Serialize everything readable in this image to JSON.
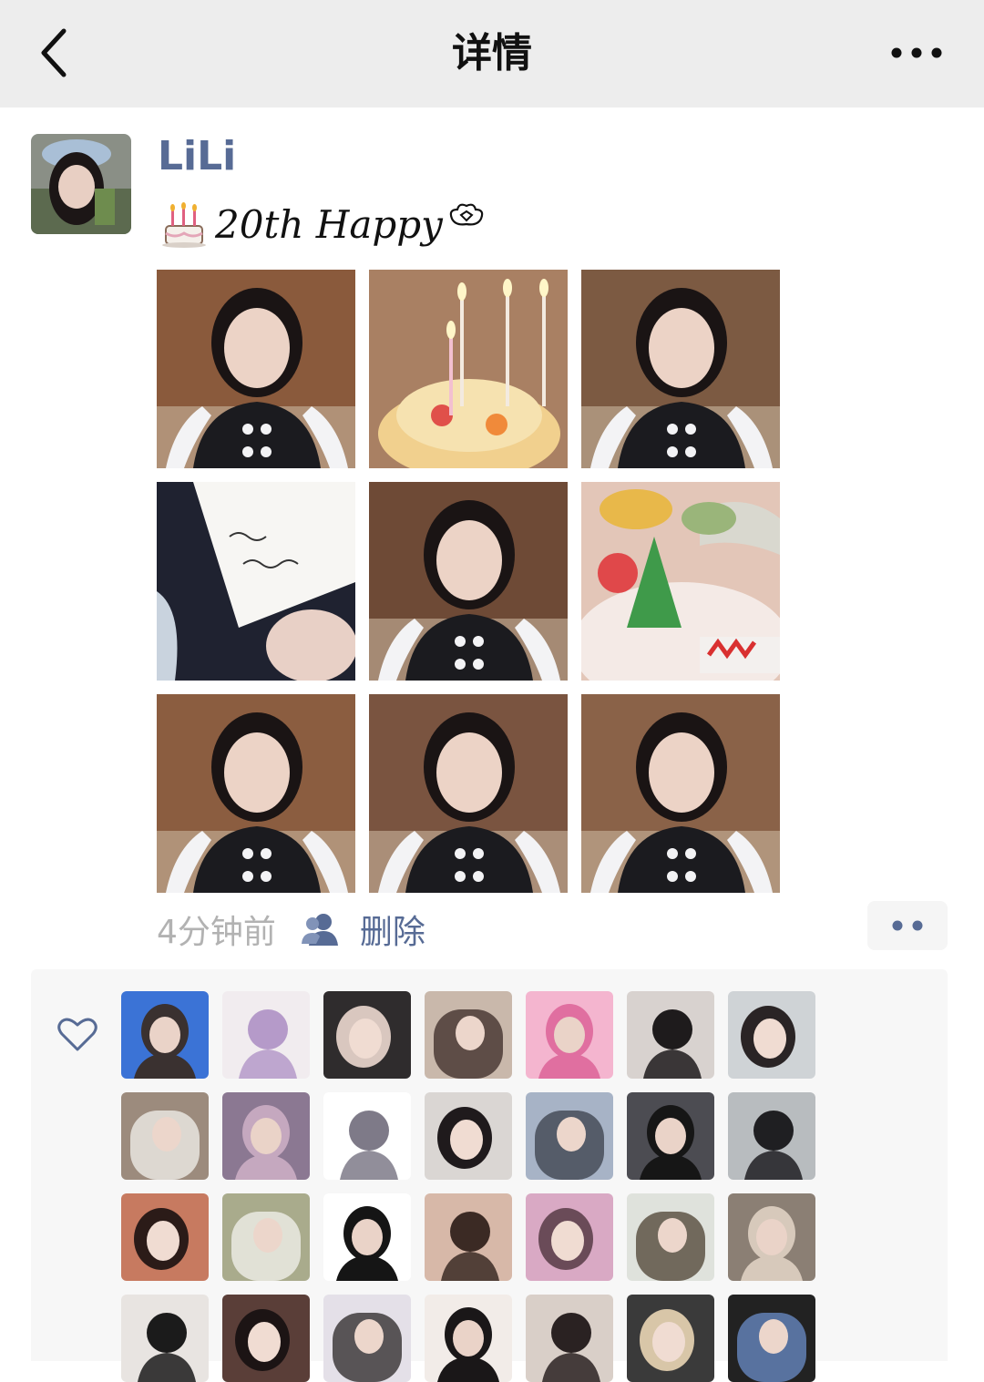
{
  "navbar": {
    "title": "详情",
    "back_icon": "chevron-left-icon",
    "more_icon": "more-dots-icon"
  },
  "post": {
    "username": "LiLi",
    "caption_prefix_icon": "birthday-cake-icon",
    "caption": "20th Happy",
    "caption_suffix_icon": "flower-outline-icon",
    "time": "4分钟前",
    "visibility_icon": "friends-icon",
    "delete_label": "删除",
    "action_icon": "two-dots-icon"
  },
  "photos": [
    {
      "name": "photo-girl-hands-raised",
      "bg": "#8a5a3c",
      "accent": "#1b1b1f"
    },
    {
      "name": "photo-birthday-cake-candles",
      "bg": "#a98063",
      "accent": "#f2c76a"
    },
    {
      "name": "photo-girl-with-cake-topper",
      "bg": "#7c5a42",
      "accent": "#1b1b1f"
    },
    {
      "name": "photo-handwritten-card",
      "bg": "#e9e6e0",
      "accent": "#2a2c3a"
    },
    {
      "name": "photo-girl-smiling-waving",
      "bg": "#6e4a36",
      "accent": "#1b1b1f"
    },
    {
      "name": "photo-christmas-cake-closeup",
      "bg": "#e3c6b8",
      "accent": "#3f9a4a"
    },
    {
      "name": "photo-girl-hand-to-face",
      "bg": "#8b5d40",
      "accent": "#1b1b1f"
    },
    {
      "name": "photo-girl-eyes-down",
      "bg": "#7a5440",
      "accent": "#1b1b1f"
    },
    {
      "name": "photo-girl-behind-cake",
      "bg": "#8a6248",
      "accent": "#1b1b1f"
    }
  ],
  "likes": {
    "heart_icon": "heart-outline-icon",
    "users": [
      {
        "bg": "#3b73d6",
        "fg": "#3a3130"
      },
      {
        "bg": "#f1ecef",
        "fg": "#b59ac9"
      },
      {
        "bg": "#2f2c2d",
        "fg": "#d9c7bf"
      },
      {
        "bg": "#c9b8ab",
        "fg": "#3a2a25"
      },
      {
        "bg": "#f4b5cf",
        "fg": "#e06fa0"
      },
      {
        "bg": "#d8d2cf",
        "fg": "#1e1b1c"
      },
      {
        "bg": "#cfd3d6",
        "fg": "#2a2425"
      },
      {
        "bg": "#9c8b7d",
        "fg": "#f3f1ee"
      },
      {
        "bg": "#8b7892",
        "fg": "#c5a8bf"
      },
      {
        "bg": "#ffffff",
        "fg": "#7e7a88"
      },
      {
        "bg": "#dad6d3",
        "fg": "#1f1a1c"
      },
      {
        "bg": "#a7b3c6",
        "fg": "#3a3f4a"
      },
      {
        "bg": "#4c4c52",
        "fg": "#161616"
      },
      {
        "bg": "#b8bcbf",
        "fg": "#1f1f22"
      },
      {
        "bg": "#c77a60",
        "fg": "#2b1b18"
      },
      {
        "bg": "#a9ab8c",
        "fg": "#f4f3ef"
      },
      {
        "bg": "#ffffff",
        "fg": "#151515"
      },
      {
        "bg": "#d7b8a8",
        "fg": "#3b2a24"
      },
      {
        "bg": "#d9a9c4",
        "fg": "#6a4b58"
      },
      {
        "bg": "#dfe2dc",
        "fg": "#4c4032"
      },
      {
        "bg": "#8b7f74",
        "fg": "#d7c9bb"
      },
      {
        "bg": "#e8e4e1",
        "fg": "#1b1b1b"
      },
      {
        "bg": "#5a3e38",
        "fg": "#1c1414"
      },
      {
        "bg": "#e4e0e8",
        "fg": "#2a2626"
      },
      {
        "bg": "#f2ece8",
        "fg": "#1a1718"
      },
      {
        "bg": "#d9cfc8",
        "fg": "#2a2222"
      },
      {
        "bg": "#3a3a3a",
        "fg": "#d8c6a8"
      },
      {
        "bg": "#222",
        "fg": "#6b8ec9"
      }
    ]
  },
  "colors": {
    "link": "#576b95",
    "muted": "#b2b2b2",
    "nav_bg": "#ededed",
    "panel_bg": "#f7f7f7"
  }
}
